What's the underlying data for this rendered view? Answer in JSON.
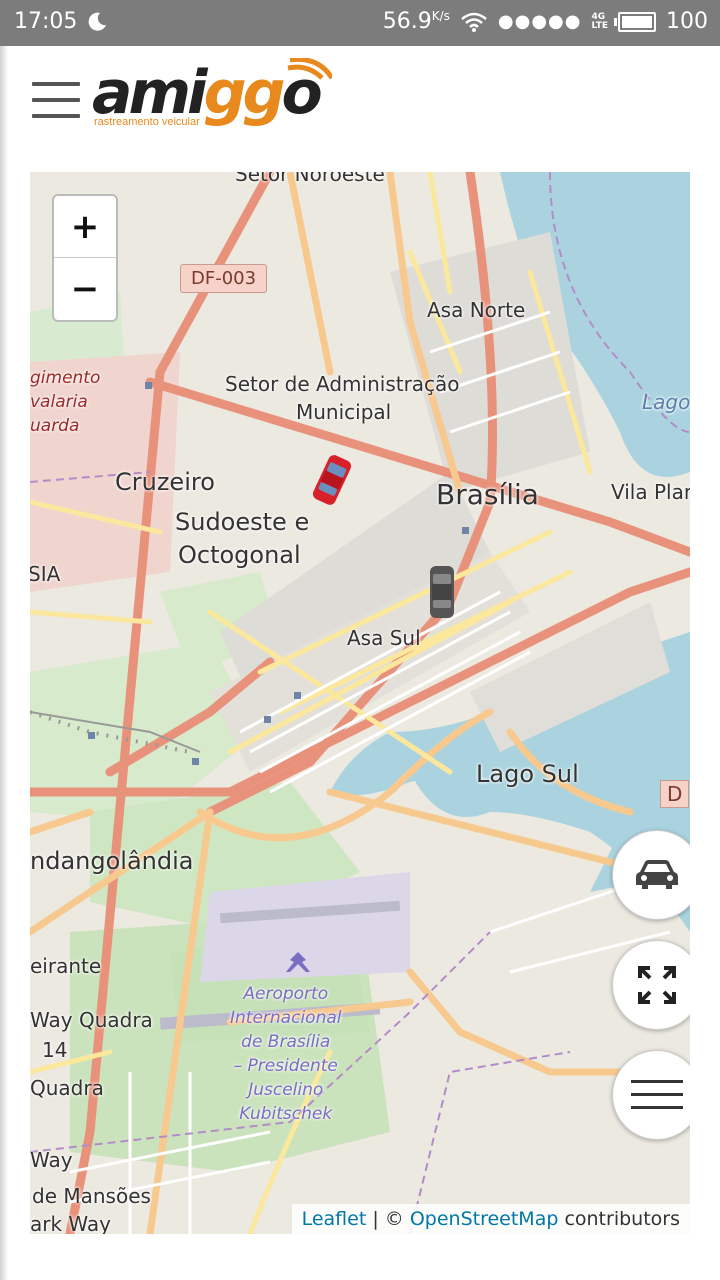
{
  "status_bar": {
    "time": "17:05",
    "network_speed": "56.9",
    "network_unit": "K/s",
    "signal_dots": "●●●●●",
    "network_type": "4G",
    "network_sub": "LTE",
    "battery_level": "100",
    "battery_fraction": 1.0
  },
  "header": {
    "menu_icon": "hamburger-icon",
    "logo": {
      "part1": "ami",
      "part2": "gg",
      "part3": "o",
      "tagline": "rastreamento veicular"
    }
  },
  "map": {
    "zoom_in": "+",
    "zoom_out": "−",
    "road_shield": "DF-003",
    "labels": {
      "setor_noroeste": "Setor Noroeste",
      "asa_norte": "Asa Norte",
      "setor_admin_1": "Setor de Administração",
      "setor_admin_2": "Municipal",
      "cruzeiro": "Cruzeiro",
      "sudoeste_1": "Sudoeste e",
      "sudoeste_2": "Octogonal",
      "brasilia": "Brasília",
      "vila_planalto": "Vila Plan",
      "asa_sul": "Asa Sul",
      "lago_sul": "Lago Sul",
      "lago": "Lago",
      "sia": "SIA",
      "candangolandia": "ndangolândia",
      "bandeirante": "eirante",
      "park_way_quadra": "Way Quadra",
      "num_14": "14",
      "quadra": "Quadra",
      "way": "Way",
      "de_mansoes": "de Mansões",
      "park_way": "ark Way",
      "regimento_1": "gimento",
      "regimento_2": "valaria",
      "regimento_3": "uarda",
      "aeroporto": [
        "Aeroporto",
        "Internacional",
        "de Brasília",
        "– Presidente",
        "Juscelino",
        "Kubitschek"
      ],
      "d_edge": "D"
    },
    "vehicles": [
      {
        "name": "red-car",
        "color": "#d8202a"
      },
      {
        "name": "gray-car",
        "color": "#555555"
      }
    ],
    "attribution": {
      "leaflet": "Leaflet",
      "sep": " | © ",
      "osm": "OpenStreetMap",
      "suffix": " contributors"
    }
  },
  "fabs": {
    "vehicles_icon": "car-icon",
    "fullscreen_icon": "expand-icon",
    "menu_icon": "menu-lines-icon"
  }
}
